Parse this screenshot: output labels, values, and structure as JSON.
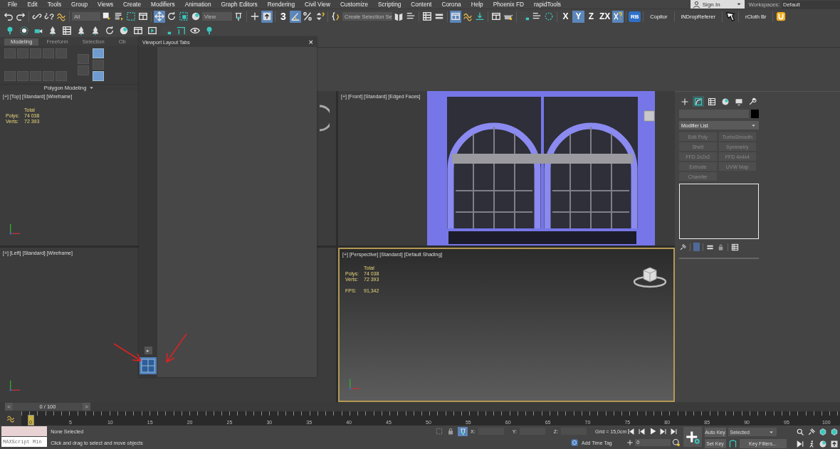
{
  "menu": [
    "File",
    "Edit",
    "Tools",
    "Group",
    "Views",
    "Create",
    "Modifiers",
    "Animation",
    "Graph Editors",
    "Rendering",
    "Civil View",
    "Customize",
    "Scripting",
    "Content",
    "Corona",
    "Help",
    "Phoenix FD",
    "rapidTools"
  ],
  "account": {
    "sign_in": "Sign In",
    "workspaces_label": "Workspaces:",
    "workspace": "Default"
  },
  "toolbar": {
    "selection_filter": "All",
    "transform_tools": [
      {
        "selected": true
      },
      {
        "selected": false
      },
      {
        "selected": false
      }
    ],
    "reference_coord": "View",
    "snap_label": "3",
    "named_selection": "Create Selection Se",
    "axis_buttons": [
      {
        "label": "X",
        "selected": false
      },
      {
        "label": "Y",
        "selected": true
      },
      {
        "label": "Z",
        "selected": false
      },
      {
        "label": "ZX",
        "selected": false
      }
    ],
    "rb_label": "RB",
    "script_buttons": [
      "Copitor",
      "iNDropReferer",
      "rCloth Br"
    ]
  },
  "ribbon": {
    "tabs": [
      {
        "label": "Modeling",
        "selected": true
      },
      {
        "label": "Freeform",
        "selected": false
      },
      {
        "label": "Selection",
        "selected": false
      },
      {
        "label": "Ob",
        "selected": false
      }
    ],
    "panel_label": "Polygon Modeling"
  },
  "floating_panel": {
    "title": "Viewport Layout Tabs",
    "close": "×",
    "expand": "▸"
  },
  "viewports": [
    {
      "kind": "ortho",
      "label": "[+] [Top] [Standard] [Wireframe]",
      "active": false,
      "stats": {
        "total": "Total",
        "rows": [
          {
            "label": "Polys:",
            "value": "74 038"
          },
          {
            "label": "Verts:",
            "value": "72 393"
          }
        ]
      }
    },
    {
      "kind": "model",
      "label": "[+] [Front] [Standard] [Edged Faces]",
      "active": false
    },
    {
      "kind": "ortho",
      "label": "[+] [Left] [Standard] [Wireframe]",
      "active": false
    },
    {
      "kind": "perspective",
      "label": "[+] [Perspective] [Standard] [Default Shading]",
      "active": true,
      "stats": {
        "total": "Total",
        "rows": [
          {
            "label": "Polys:",
            "value": "74 038"
          },
          {
            "label": "Verts:",
            "value": "72 393"
          }
        ],
        "fps": {
          "label": "FPS:",
          "value": "91,342"
        }
      }
    }
  ],
  "command_panel": {
    "tabs": [
      {
        "selected": false
      },
      {
        "selected": true
      },
      {
        "selected": false
      },
      {
        "selected": false
      },
      {
        "selected": false
      },
      {
        "selected": false
      }
    ],
    "modifier_list": "Modifier List",
    "modifier_buttons": [
      "Edit Poly",
      "TurboSmooth",
      "Shell",
      "Symmetry",
      "FFD 2x2x2",
      "FFD 4x4x4",
      "Extrude",
      "UVW Map",
      "Chamfer"
    ]
  },
  "timeline": {
    "level": 0,
    "prev": "<",
    "counter": "0 / 100",
    "next": ">",
    "ticks": [
      "0",
      "5",
      "10",
      "15",
      "20",
      "25",
      "30",
      "35",
      "40",
      "45",
      "50",
      "55",
      "60",
      "65",
      "70",
      "75",
      "80",
      "85",
      "90",
      "95",
      "100"
    ]
  },
  "status": {
    "maxscript": "MAXScript Min",
    "selection": "None Selected",
    "prompt": "Click and drag to select and move objects",
    "x_label": "X:",
    "y_label": "Y:",
    "z_label": "Z:",
    "grid": "Grid = 15,0cm",
    "time_tag": "Add Time Tag",
    "frame": "0",
    "auto_key": "Auto Key",
    "key_mode": "Selected",
    "set_key": "Set Key",
    "key_filters": "Key Filters..."
  }
}
